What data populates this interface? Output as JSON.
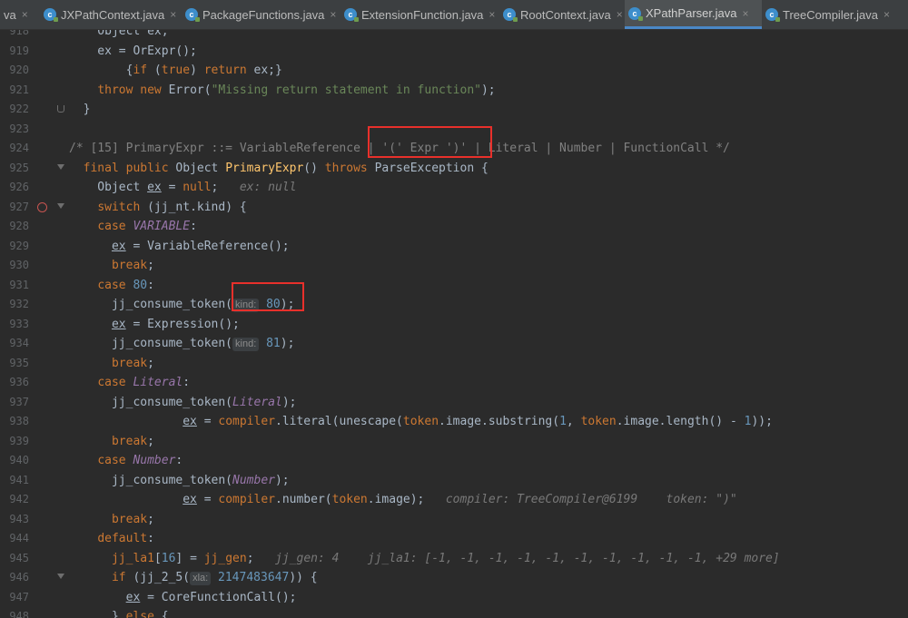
{
  "tabs": [
    {
      "name": "va",
      "icon": "",
      "active": false
    },
    {
      "name": "JXPathContext.java",
      "icon": "class-icon",
      "active": false
    },
    {
      "name": "PackageFunctions.java",
      "icon": "class-icon",
      "active": false
    },
    {
      "name": "ExtensionFunction.java",
      "icon": "class-icon",
      "active": false
    },
    {
      "name": "RootContext.java",
      "icon": "class-icon",
      "active": false
    },
    {
      "name": "XPathParser.java",
      "icon": "class-icon",
      "active": true
    },
    {
      "name": "TreeCompiler.java",
      "icon": "class-icon",
      "active": false
    }
  ],
  "colors": {
    "accent": "#4a88c7",
    "highlight_box": "#e8302b",
    "breakpoint": "#c75450"
  },
  "editor": {
    "lines": [
      {
        "n": "918",
        "tokens": [
          [
            "    Object ex;",
            ""
          ]
        ]
      },
      {
        "n": "919",
        "tokens": [
          [
            "    ex = OrExpr();",
            ""
          ]
        ]
      },
      {
        "n": "920",
        "tokens": [
          [
            "        {",
            ""
          ],
          [
            "if",
            "kw"
          ],
          [
            " (",
            ""
          ],
          [
            "true",
            "kw"
          ],
          [
            ") ",
            ""
          ],
          [
            "return",
            "kw"
          ],
          [
            " ex;}",
            ""
          ]
        ]
      },
      {
        "n": "921",
        "tokens": [
          [
            "    ",
            ""
          ],
          [
            "throw new",
            "kw"
          ],
          [
            " Error(",
            ""
          ],
          [
            "\"Missing return statement in function\"",
            "str"
          ],
          [
            ");",
            ""
          ]
        ]
      },
      {
        "n": "922",
        "tokens": [
          [
            "  }",
            ""
          ]
        ]
      },
      {
        "n": "923",
        "tokens": []
      },
      {
        "n": "924",
        "tokens": [
          [
            "/* [15] PrimaryExpr ::= VariableReference | '(' Expr ')' | Literal | Number | FunctionCall */",
            "cm"
          ]
        ]
      },
      {
        "n": "925",
        "tokens": [
          [
            "  ",
            ""
          ],
          [
            "final public",
            "kw"
          ],
          [
            " Object ",
            ""
          ],
          [
            "PrimaryExpr",
            "fn"
          ],
          [
            "() ",
            ""
          ],
          [
            "throws",
            "kw"
          ],
          [
            " ParseException {",
            ""
          ]
        ]
      },
      {
        "n": "926",
        "tokens": [
          [
            "    Object ",
            ""
          ],
          [
            "ex",
            "ul"
          ],
          [
            " = ",
            ""
          ],
          [
            "null",
            "kw"
          ],
          [
            ";   ",
            ""
          ],
          [
            "ex: null",
            "hint"
          ]
        ]
      },
      {
        "n": "927",
        "tokens": [
          [
            "    ",
            ""
          ],
          [
            "switch",
            "kw"
          ],
          [
            " (jj_nt.kind) {",
            ""
          ]
        ]
      },
      {
        "n": "928",
        "tokens": [
          [
            "    ",
            ""
          ],
          [
            "case",
            "kw"
          ],
          [
            " ",
            ""
          ],
          [
            "VARIABLE",
            "it"
          ],
          [
            ":",
            ""
          ]
        ]
      },
      {
        "n": "929",
        "tokens": [
          [
            "      ",
            ""
          ],
          [
            "ex",
            "ul"
          ],
          [
            " = VariableReference();",
            ""
          ]
        ]
      },
      {
        "n": "930",
        "tokens": [
          [
            "      ",
            ""
          ],
          [
            "break",
            "kw"
          ],
          [
            ";",
            ""
          ]
        ]
      },
      {
        "n": "931",
        "tokens": [
          [
            "    ",
            ""
          ],
          [
            "case",
            "kw"
          ],
          [
            " ",
            ""
          ],
          [
            "80",
            "num"
          ],
          [
            ":",
            ""
          ]
        ]
      },
      {
        "n": "932",
        "tokens": [
          [
            "      jj_consume_token(",
            ""
          ],
          [
            "kind:",
            "phint"
          ],
          [
            " ",
            ""
          ],
          [
            "80",
            "num"
          ],
          [
            ");",
            ""
          ]
        ]
      },
      {
        "n": "933",
        "tokens": [
          [
            "      ",
            ""
          ],
          [
            "ex",
            "ul"
          ],
          [
            " = Expression();",
            ""
          ]
        ]
      },
      {
        "n": "934",
        "tokens": [
          [
            "      jj_consume_token(",
            ""
          ],
          [
            "kind:",
            "phint"
          ],
          [
            " ",
            ""
          ],
          [
            "81",
            "num"
          ],
          [
            ");",
            ""
          ]
        ]
      },
      {
        "n": "935",
        "tokens": [
          [
            "      ",
            ""
          ],
          [
            "break",
            "kw"
          ],
          [
            ";",
            ""
          ]
        ]
      },
      {
        "n": "936",
        "tokens": [
          [
            "    ",
            ""
          ],
          [
            "case",
            "kw"
          ],
          [
            " ",
            ""
          ],
          [
            "Literal",
            "it"
          ],
          [
            ":",
            ""
          ]
        ]
      },
      {
        "n": "937",
        "tokens": [
          [
            "      jj_consume_token(",
            ""
          ],
          [
            "Literal",
            "it"
          ],
          [
            ");",
            ""
          ]
        ]
      },
      {
        "n": "938",
        "tokens": [
          [
            "                ",
            ""
          ],
          [
            "ex",
            "ul"
          ],
          [
            " = ",
            ""
          ],
          [
            "compiler",
            "kw"
          ],
          [
            ".literal(unescape(",
            ""
          ],
          [
            "token",
            "kw"
          ],
          [
            ".image.substring(",
            ""
          ],
          [
            "1",
            "num"
          ],
          [
            ", ",
            ""
          ],
          [
            "token",
            "kw"
          ],
          [
            ".image.length() - ",
            ""
          ],
          [
            "1",
            "num"
          ],
          [
            "));",
            ""
          ]
        ]
      },
      {
        "n": "939",
        "tokens": [
          [
            "      ",
            ""
          ],
          [
            "break",
            "kw"
          ],
          [
            ";",
            ""
          ]
        ]
      },
      {
        "n": "940",
        "tokens": [
          [
            "    ",
            ""
          ],
          [
            "case",
            "kw"
          ],
          [
            " ",
            ""
          ],
          [
            "Number",
            "it"
          ],
          [
            ":",
            ""
          ]
        ]
      },
      {
        "n": "941",
        "tokens": [
          [
            "      jj_consume_token(",
            ""
          ],
          [
            "Number",
            "it"
          ],
          [
            ");",
            ""
          ]
        ]
      },
      {
        "n": "942",
        "tokens": [
          [
            "                ",
            ""
          ],
          [
            "ex",
            "ul"
          ],
          [
            " = ",
            ""
          ],
          [
            "compiler",
            "kw"
          ],
          [
            ".number(",
            ""
          ],
          [
            "token",
            "kw"
          ],
          [
            ".image);   ",
            ""
          ],
          [
            "compiler: TreeCompiler@6199    token: \")\"",
            "hint"
          ]
        ]
      },
      {
        "n": "943",
        "tokens": [
          [
            "      ",
            ""
          ],
          [
            "break",
            "kw"
          ],
          [
            ";",
            ""
          ]
        ]
      },
      {
        "n": "944",
        "tokens": [
          [
            "    ",
            ""
          ],
          [
            "default",
            "kw"
          ],
          [
            ":",
            ""
          ]
        ]
      },
      {
        "n": "945",
        "tokens": [
          [
            "      ",
            ""
          ],
          [
            "jj_la1",
            "kw"
          ],
          [
            "[",
            ""
          ],
          [
            "16",
            "num"
          ],
          [
            "] = ",
            ""
          ],
          [
            "jj_gen",
            "kw"
          ],
          [
            ";   ",
            ""
          ],
          [
            "jj_gen: 4    jj_la1: [-1, -1, -1, -1, -1, -1, -1, -1, -1, -1, +29 more]",
            "hint"
          ]
        ]
      },
      {
        "n": "946",
        "tokens": [
          [
            "      ",
            ""
          ],
          [
            "if",
            "kw"
          ],
          [
            " (jj_2_5(",
            ""
          ],
          [
            "xla:",
            "phint"
          ],
          [
            " ",
            ""
          ],
          [
            "2147483647",
            "num"
          ],
          [
            ")) {",
            ""
          ]
        ]
      },
      {
        "n": "947",
        "tokens": [
          [
            "        ",
            ""
          ],
          [
            "ex",
            "ul"
          ],
          [
            " = CoreFunctionCall();",
            ""
          ]
        ]
      },
      {
        "n": "948",
        "tokens": [
          [
            "      } ",
            ""
          ],
          [
            "else",
            "kw"
          ],
          [
            " {",
            ""
          ]
        ]
      }
    ]
  }
}
